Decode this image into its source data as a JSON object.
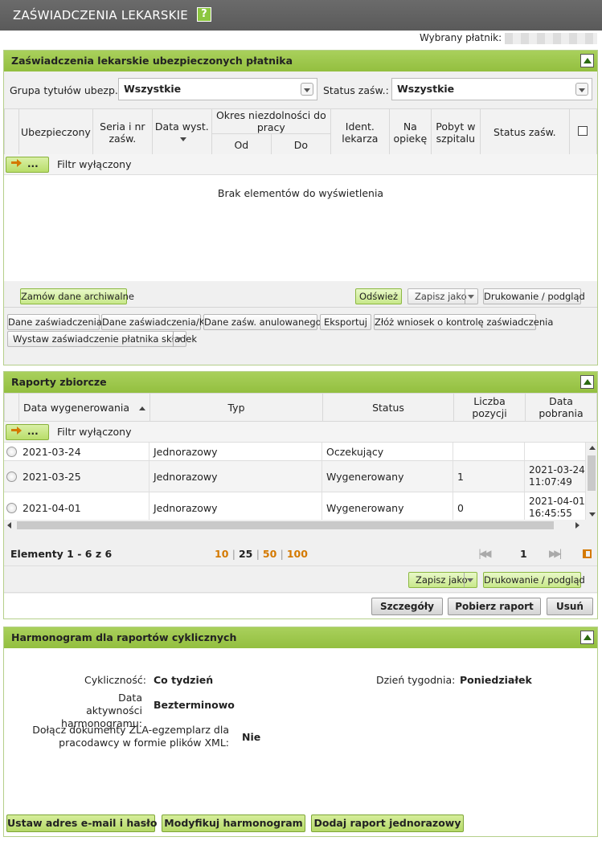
{
  "page_title": "ZAŚWIADCZENIA LEKARSKIE",
  "help_icon_label": "?",
  "payer_label": "Wybrany płatnik:",
  "panel1": {
    "title": "Zaświadczenia lekarskie ubezpieczonych płatnika",
    "group_label": "Grupa tytułów ubezp.:",
    "group_value": "Wszystkie",
    "status_label": "Status zaśw.:",
    "status_value": "Wszystkie",
    "columns": {
      "insured": "Ubezpieczony",
      "series": "Seria i nr zaśw.",
      "date_issued": "Data wyst.",
      "period": "Okres niezdolności do pracy",
      "from": "Od",
      "to": "Do",
      "doctor": "Ident. lekarza",
      "care": "Na opiekę",
      "hospital": "Pobyt w szpitalu",
      "status": "Status zaśw."
    },
    "filter_button": "...",
    "filter_text": "Filtr wyłączony",
    "empty_text": "Brak elementów do wyświetlenia",
    "buttons": {
      "order_archive": "Zamów dane archiwalne",
      "refresh": "Odśwież",
      "save_as": "Zapisz jako",
      "print": "Drukowanie / podgląd"
    },
    "actions": [
      "Dane zaświadczenia",
      "Dane zaświadczenia/K",
      "Dane zaśw. anulowanego",
      "Eksportuj",
      "Złóż wniosek o kontrolę zaświadczenia"
    ],
    "issue_cert": "Wystaw zaświadczenie płatnika składek"
  },
  "panel2": {
    "title": "Raporty zbiorcze",
    "columns": {
      "date_generated": "Data wygenerowania",
      "type": "Typ",
      "status": "Status",
      "count": "Liczba pozycji",
      "date_downloaded": "Data pobrania"
    },
    "filter_button": "...",
    "filter_text": "Filtr wyłączony",
    "rows": [
      {
        "date": "2021-03-24",
        "type": "Jednorazowy",
        "status": "Oczekujący",
        "count": "",
        "downloaded": ""
      },
      {
        "date": "2021-03-25",
        "type": "Jednorazowy",
        "status": "Wygenerowany",
        "count": "1",
        "downloaded": "2021-03-24 11:07:49"
      },
      {
        "date": "2021-04-01",
        "type": "Jednorazowy",
        "status": "Wygenerowany",
        "count": "0",
        "downloaded": "2021-04-01 16:45:55"
      }
    ],
    "elements_info": "Elementy 1 - 6 z 6",
    "page_sizes": [
      "10",
      "25",
      "50",
      "100"
    ],
    "current_page": "1",
    "buttons": {
      "save_as": "Zapisz jako",
      "print": "Drukowanie / podgląd",
      "details": "Szczegóły",
      "download": "Pobierz raport",
      "delete": "Usuń"
    }
  },
  "panel3": {
    "title": "Harmonogram dla raportów cyklicznych",
    "cyclicity_label": "Cykliczność:",
    "cyclicity_value": "Co tydzień",
    "weekday_label": "Dzień tygodnia:",
    "weekday_value": "Poniedziałek",
    "activity_label": "Data aktywności harmonogramu:",
    "activity_value": "Bezterminowo",
    "attach_label": "Dołącz dokumenty ZLA-egzemplarz dla pracodawcy w formie plików XML:",
    "attach_value": "Nie",
    "buttons": {
      "email": "Ustaw adres e-mail i hasło",
      "modify": "Modyfikuj harmonogram",
      "add_once": "Dodaj raport jednorazowy"
    }
  }
}
